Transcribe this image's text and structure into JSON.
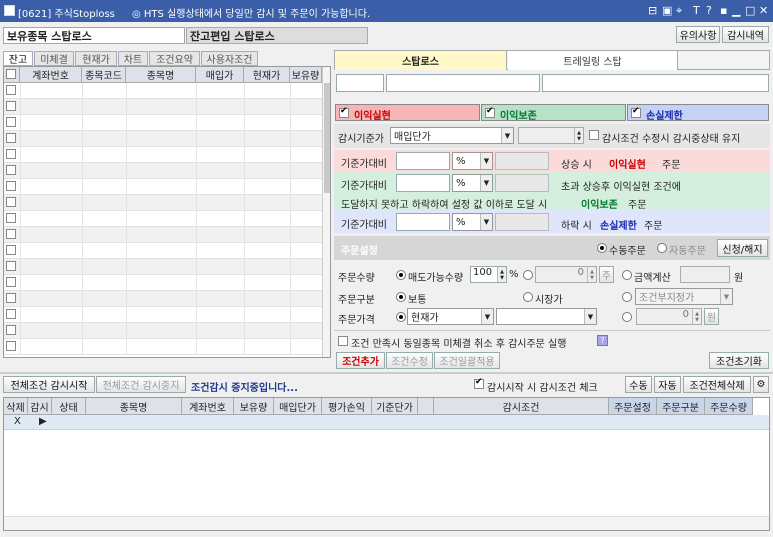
{
  "window": {
    "title": "[0621] 주식Stoploss",
    "notice": "◎ HTS 실행상태에서 당일만 감시 및 주문이 가능합니다."
  },
  "titlebar_icons": [
    "restore-icon",
    "copy-icon",
    "pin-icon",
    "help-icon",
    "font-size-icon",
    "minimize-icon",
    "maximize-icon",
    "close-icon"
  ],
  "titlebar_glyphs": [
    "⊟",
    "▣",
    "⌖",
    "T",
    "?",
    "▪",
    "▁",
    "□",
    "✕"
  ],
  "header": {
    "panel1": "보유종목 스탑로스",
    "panel2": "잔고편입 스탑로스",
    "notice_btn": "유의사항",
    "history_btn": "감시내역"
  },
  "left_tabs": [
    "잔고",
    "미체결",
    "현재가",
    "차트",
    "조건요약",
    "사용자조건"
  ],
  "holdings_columns": [
    "계좌번호",
    "종목코드",
    "종목명",
    "매입가",
    "현재가",
    "보유량"
  ],
  "right_tabs": [
    "스탑로스",
    "트레일링 스탑"
  ],
  "conditions": {
    "profit": "이익실현",
    "breakeven": "이익보존",
    "loss": "손실제한"
  },
  "colors": {
    "profit_bg": "#f8b5b5",
    "breakeven_bg": "#b8e2c8",
    "loss_bg": "#c6d1f6",
    "accent_text": "#1a3a8c",
    "profit_text": "#c80000",
    "breakeven_text": "#007a2e",
    "loss_text": "#1a2ab0"
  },
  "base": {
    "label": "감시기준가",
    "value": "매입단가",
    "keep_label": "감시조건 수정시 감시중상태 유지"
  },
  "profit_row": {
    "label": "기준가대비",
    "unit": "%",
    "text1": "상승 시",
    "text2": "이익실현",
    "text3": "주문"
  },
  "breakeven_row": {
    "label": "기준가대비",
    "unit": "%",
    "text1": "초과 상승후 이익실현 조건에",
    "line2a": "도달하지 못하고 하락하여 설정 값 이하로 도달 시",
    "line2b": "이익보존",
    "line2c": "주문"
  },
  "loss_row": {
    "label": "기준가대비",
    "unit": "%",
    "text1": "하락 시",
    "text2": "손실제한",
    "text3": "주문"
  },
  "order_setting": {
    "title": "주문설정",
    "manual": "수동주문",
    "auto": "자동주문",
    "apply_btn": "신청/해지"
  },
  "order_qty": {
    "label": "주문수량",
    "option": "매도가능수량",
    "pct": "100",
    "pct_unit": "%",
    "qty_value": "0",
    "qty_unit": "주",
    "amount_label": "금액계산",
    "amount_unit": "원"
  },
  "order_type": {
    "label": "주문구분",
    "normal": "보통",
    "market": "시장가",
    "cond_placeholder": "조건부지정가"
  },
  "order_price": {
    "label": "주문가격",
    "price_type": "현재가",
    "price_value": "0",
    "price_unit": "원"
  },
  "cancel_option": "조건 만족시 동일종목 미체결 취소 후 감시주문 실행",
  "cond_buttons": {
    "add": "조건추가",
    "modify": "조건수정",
    "batch": "조건일괄적용",
    "reset": "조건초기화"
  },
  "monitor_bar": {
    "start_all": "전체조건 감시시작",
    "stop_all": "전체조건 감시중지",
    "status": "조건감시 중지중입니다...",
    "check_label": "감시시작 시 감시조건 체크",
    "manual": "수동",
    "auto": "자동",
    "delete_all": "조건전체삭제"
  },
  "monitor_columns": [
    "삭제",
    "감시",
    "상태",
    "종목명",
    "계좌번호",
    "보유량",
    "매입단가",
    "평가손익",
    "기준단가",
    "",
    "감시조건",
    "주문설정",
    "주문구분",
    "주문수량"
  ],
  "monitor_first_row": {
    "delete": "X",
    "watch": "▶"
  }
}
